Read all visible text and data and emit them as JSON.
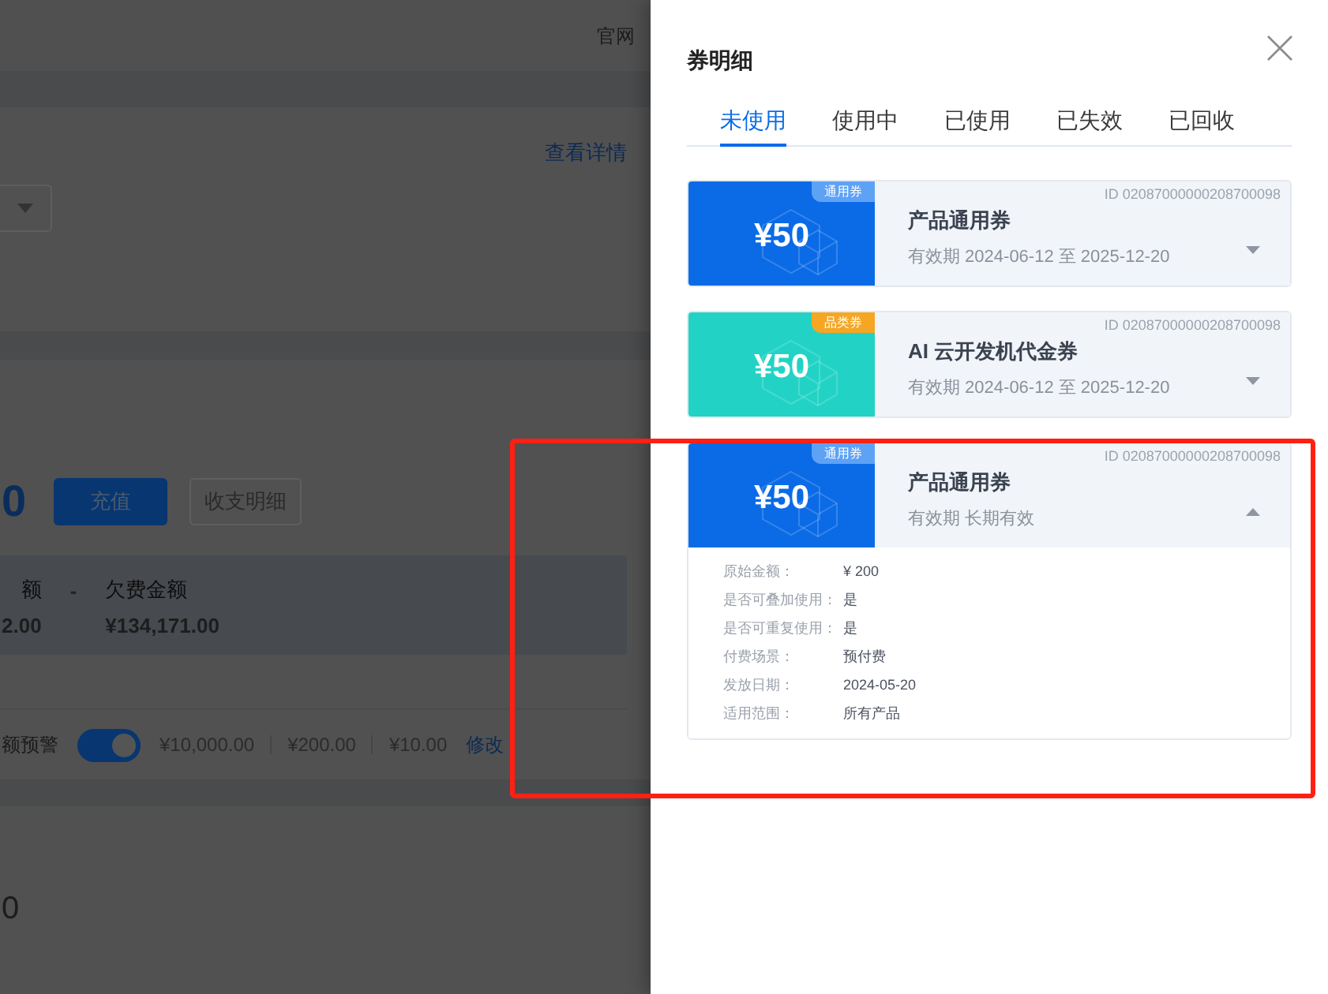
{
  "background_page": {
    "header_link": "官网",
    "detail_link": "查看详情",
    "balance_value": "0",
    "buttons": [
      {
        "label": "充值",
        "kind": "primary"
      },
      {
        "label": "收支明细",
        "kind": "secondary"
      }
    ],
    "summary": [
      {
        "label": "额",
        "value": "2.00"
      },
      {
        "label": "欠费金额",
        "value": "¥134,171.00"
      }
    ],
    "summary_separator": "-",
    "alert": {
      "label": "额预警",
      "on": true,
      "amounts": [
        "¥10,000.00",
        "¥200.00",
        "¥10.00"
      ],
      "edit_link": "修改"
    },
    "bottom_value": "0"
  },
  "drawer": {
    "title": "券明细",
    "tabs": [
      {
        "label": "未使用",
        "selected": true
      },
      {
        "label": "使用中",
        "selected": false
      },
      {
        "label": "已使用",
        "selected": false
      },
      {
        "label": "已失效",
        "selected": false
      },
      {
        "label": "已回收",
        "selected": false
      }
    ],
    "coupons": [
      {
        "kind": "general",
        "badge": "通用券",
        "amount": "¥50",
        "id": "ID 02087000000208700098",
        "title": "产品通用券",
        "validity": "有效期 2024-06-12 至 2025-12-20",
        "expanded": false
      },
      {
        "kind": "category",
        "badge": "品类券",
        "amount": "¥50",
        "id": "ID 02087000000208700098",
        "title": "AI 云开发机代金券",
        "validity": "有效期 2024-06-12 至 2025-12-20",
        "expanded": false
      },
      {
        "kind": "general",
        "badge": "通用券",
        "amount": "¥50",
        "id": "ID 02087000000208700098",
        "title": "产品通用券",
        "validity": "有效期 长期有效",
        "expanded": true,
        "details": [
          {
            "label": "原始金额：",
            "value": "¥ 200"
          },
          {
            "label": "是否可叠加使用：",
            "value": "是"
          },
          {
            "label": "是否可重复使用：",
            "value": "是"
          },
          {
            "label": "付费场景：",
            "value": "预付费"
          },
          {
            "label": "发放日期：",
            "value": "2024-05-20"
          },
          {
            "label": "适用范围：",
            "value": "所有产品"
          }
        ]
      }
    ]
  }
}
